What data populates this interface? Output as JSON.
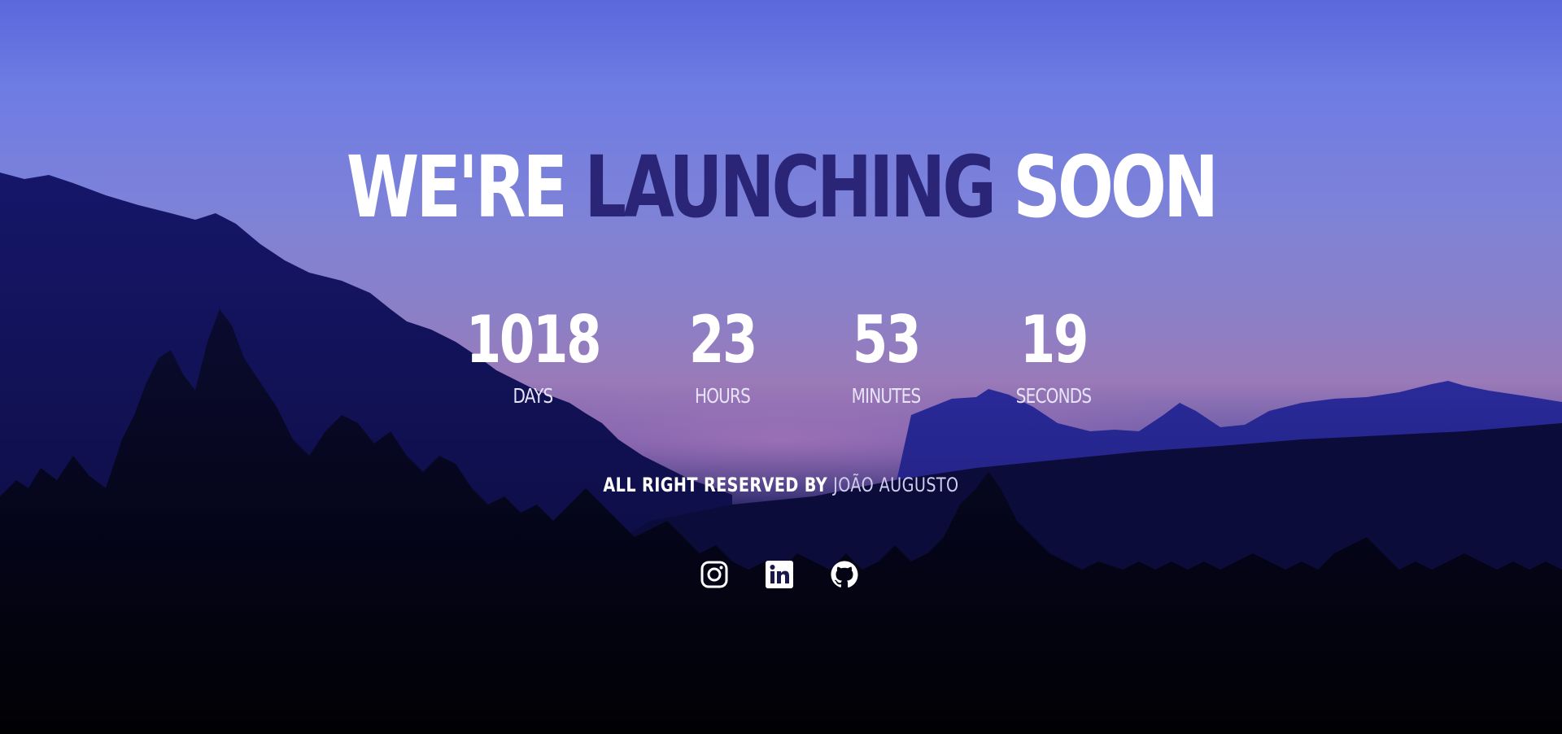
{
  "hero": {
    "title_part1": "WE'RE ",
    "title_accent": "LAUNCHING",
    "title_part2": " SOON"
  },
  "countdown": [
    {
      "value": "1018",
      "label": "DAYS"
    },
    {
      "value": "23",
      "label": "HOURS"
    },
    {
      "value": "53",
      "label": "MINUTES"
    },
    {
      "value": "19",
      "label": "SECONDS"
    }
  ],
  "footer": {
    "text": "ALL RIGHT RESERVED BY ",
    "author": "JOÃO AUGUSTO"
  },
  "socials": [
    {
      "icon": "instagram-icon"
    },
    {
      "icon": "linkedin-icon"
    },
    {
      "icon": "github-icon"
    }
  ],
  "colors": {
    "accent": "#2b2577",
    "text": "#ffffff",
    "sky_top": "#5a68dc",
    "sky_glow": "#9a7ab8"
  }
}
